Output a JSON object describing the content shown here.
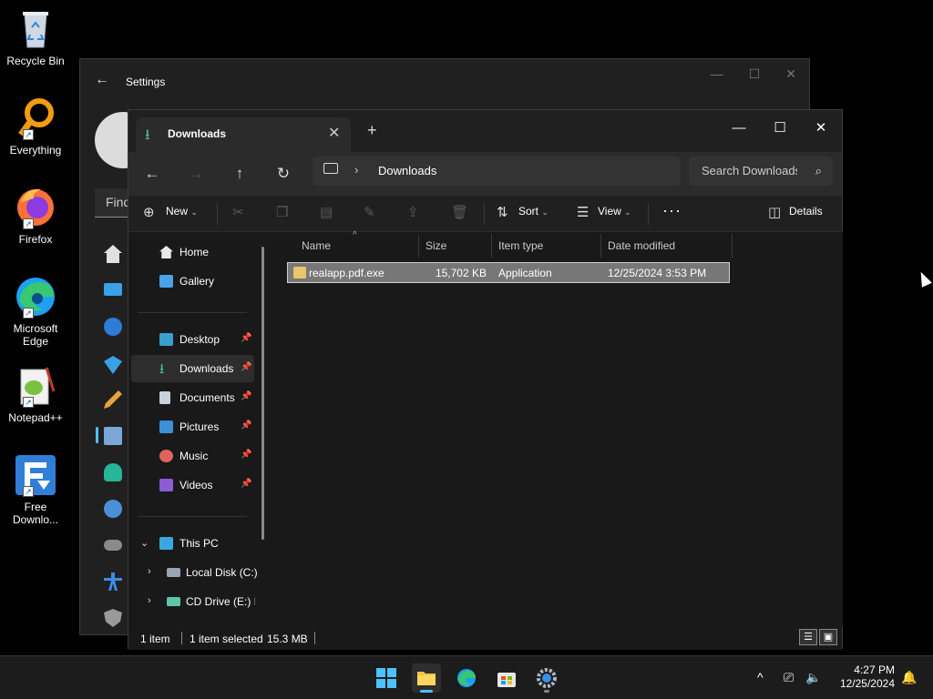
{
  "desktop": {
    "icons": [
      {
        "label": "Recycle Bin"
      },
      {
        "label": "Everything"
      },
      {
        "label": "Firefox"
      },
      {
        "label": "Microsoft Edge"
      },
      {
        "label": "Notepad++"
      },
      {
        "label": "Free Downlo..."
      }
    ]
  },
  "settings": {
    "title": "Settings",
    "search_placeholder": "Find"
  },
  "explorer": {
    "tab_label": "Downloads",
    "address_crumb": "Downloads",
    "search_placeholder": "Search Downloads",
    "commands": {
      "new": "New",
      "sort": "Sort",
      "view": "View",
      "details": "Details"
    },
    "nav": {
      "home": "Home",
      "gallery": "Gallery",
      "desktop": "Desktop",
      "downloads": "Downloads",
      "documents": "Documents",
      "pictures": "Pictures",
      "music": "Music",
      "videos": "Videos",
      "this_pc": "This PC",
      "local_disk": "Local Disk (C:)",
      "cd_drive": "CD Drive (E:) IF"
    },
    "columns": {
      "name": "Name",
      "size": "Size",
      "type": "Item type",
      "modified": "Date modified"
    },
    "files": [
      {
        "name": "realapp.pdf.exe",
        "size": "15,702 KB",
        "type": "Application",
        "modified": "12/25/2024 3:53 PM"
      }
    ],
    "status": {
      "count": "1 item",
      "selection": "1 item selected",
      "size": "15.3 MB"
    }
  },
  "taskbar": {
    "time": "4:27 PM",
    "date": "12/25/2024"
  },
  "colors": {
    "accent_green": "#4cc38a",
    "window_bg": "#191919",
    "selection": "#777777"
  }
}
